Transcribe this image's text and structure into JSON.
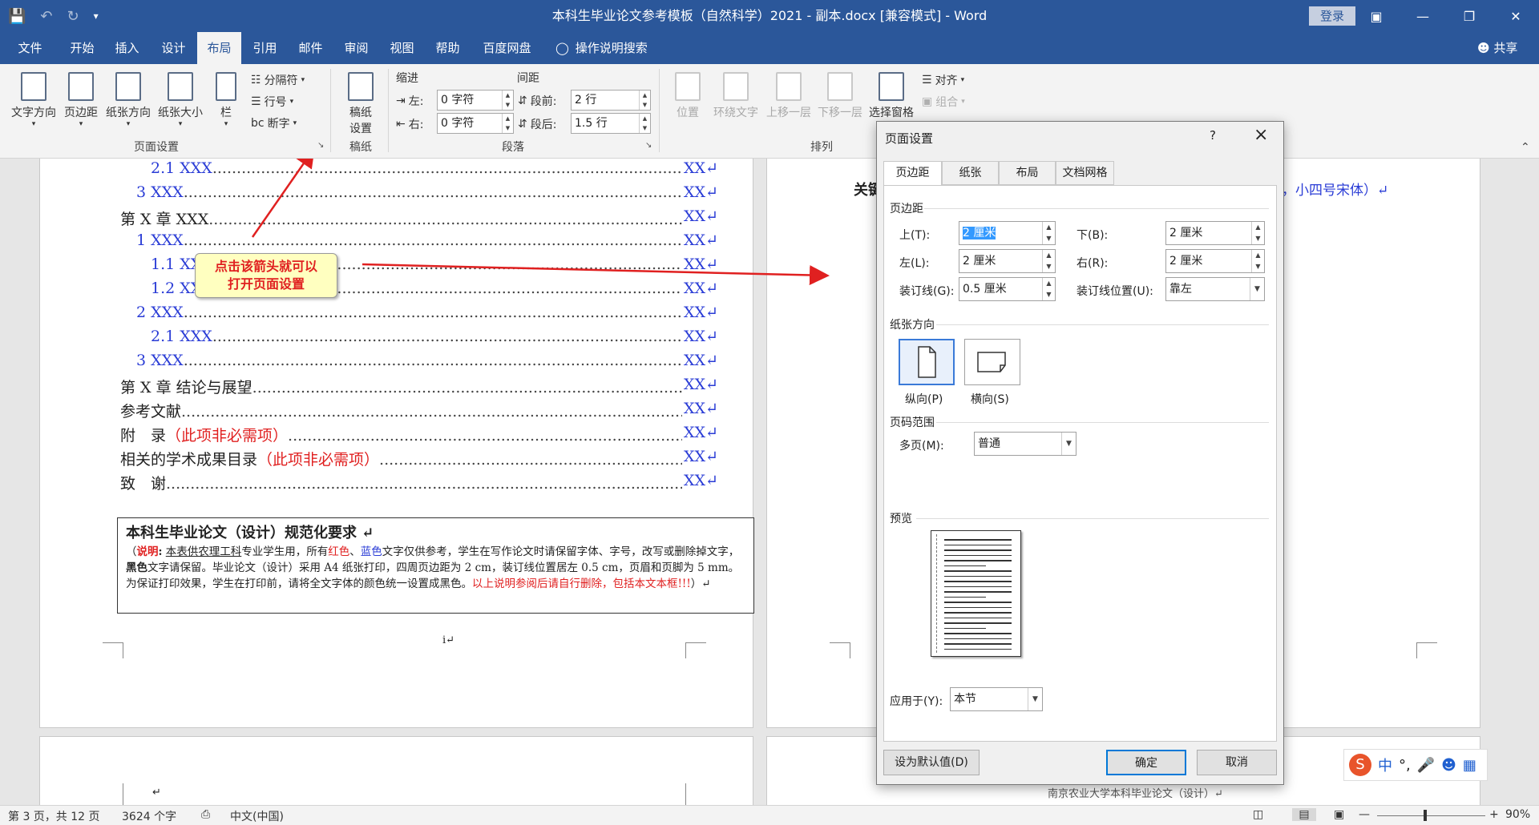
{
  "window": {
    "title": "本科生毕业论文参考模板（自然科学）2021 - 副本.docx [兼容模式] - Word",
    "login": "登录",
    "share": "共享",
    "search": "操作说明搜索"
  },
  "tabs": [
    "文件",
    "开始",
    "插入",
    "设计",
    "布局",
    "引用",
    "邮件",
    "审阅",
    "视图",
    "帮助",
    "百度网盘"
  ],
  "ribbon": {
    "page_setup": {
      "text_direction": "文字方向",
      "margins": "页边距",
      "orientation": "纸张方向",
      "size": "纸张大小",
      "columns": "栏",
      "breaks": "分隔符",
      "line_numbers": "行号",
      "hyphenation": "断字",
      "group": "页面设置"
    },
    "draft": {
      "button_line1": "稿纸",
      "button_line2": "设置",
      "group": "稿纸"
    },
    "paragraph": {
      "indent_label": "缩进",
      "spacing_label": "间距",
      "left_label": "左:",
      "right_label": "右:",
      "before_label": "段前:",
      "after_label": "段后:",
      "left_value": "0 字符",
      "right_value": "0 字符",
      "before_value": "2 行",
      "after_value": "1.5 行",
      "group": "段落"
    },
    "arrange": {
      "position": "位置",
      "wrap": "环绕文字",
      "forward": "上移一层",
      "backward": "下移一层",
      "selection": "选择窗格",
      "align": "对齐",
      "group_btn": "组合",
      "group": "排列"
    }
  },
  "toc": [
    {
      "label": "2.1 XXX",
      "color": "blue",
      "page": "XX"
    },
    {
      "label": "3 XXX",
      "color": "blue",
      "page": "XX"
    },
    {
      "label": "第 X 章 XXX",
      "color": "mixed",
      "page": "XX"
    },
    {
      "label": "1 XXX",
      "color": "blue",
      "page": "XX"
    },
    {
      "label": "1.1 XX",
      "color": "blue",
      "page": "XX"
    },
    {
      "label": "1.2 XX",
      "color": "blue",
      "page": "XX"
    },
    {
      "label": "2 XXX",
      "color": "blue",
      "page": "XX"
    },
    {
      "label": "2.1 XXX",
      "color": "blue",
      "page": "XX"
    },
    {
      "label": "3 XXX",
      "color": "blue",
      "page": "XX"
    },
    {
      "label": "第 X 章 结论与展望",
      "color": "mixed",
      "page": "XX"
    },
    {
      "label": "参考文献",
      "color": "black",
      "page": "XX"
    },
    {
      "label": "附　录",
      "suffix": "（此项非必需项）",
      "color": "black",
      "page": "XX"
    },
    {
      "label": "相关的学术成果目录",
      "suffix": "（此项非必需项）",
      "color": "black",
      "page": "XX"
    },
    {
      "label": "致　谢",
      "color": "black",
      "page": "XX"
    }
  ],
  "callout": {
    "line1": "点击该箭头就可以",
    "line2": "打开页面设置"
  },
  "note": {
    "heading": "本科生毕业论文（设计）规范化要求",
    "p1": "说明",
    "p2": "本表供农理工科",
    "p3": "专业学生用，所有",
    "p4": "红色",
    "p5": "蓝色",
    "p6": "文字仅供参考，学生在写作论文时请保留字体、字号，改写或删除掉文字，",
    "p7": "黑色",
    "p8": "文字请保留。毕业论文（设计）采用 A4 纸张打印，四周页边距为 2 cm，装订线位置居左 0.5 cm，页眉和页脚为 5 mm。为保证打印效果，学生在打印前，请将全文字体的颜色统一设置成黑色。",
    "p9": "以上说明参阅后请自行删除，包括本文本框!!!"
  },
  "page_num": "i",
  "right_page": {
    "keyword": "关键",
    "hint": "，小四号宋体）",
    "footer": "南京农业大学本科毕业论文（设计）"
  },
  "dialog": {
    "title": "页面设置",
    "tabs": [
      "页边距",
      "纸张",
      "布局",
      "文档网格"
    ],
    "margins_section": "页边距",
    "top_label": "上(T):",
    "top_value": "2 厘米",
    "bottom_label": "下(B):",
    "bottom_value": "2 厘米",
    "left_label": "左(L):",
    "left_value": "2 厘米",
    "right_label": "右(R):",
    "right_value": "2 厘米",
    "gutter_label": "装订线(G):",
    "gutter_value": "0.5 厘米",
    "gutter_pos_label": "装订线位置(U):",
    "gutter_pos_value": "靠左",
    "orientation_section": "纸张方向",
    "portrait": "纵向(P)",
    "landscape": "横向(S)",
    "pages_section": "页码范围",
    "multi_label": "多页(M):",
    "multi_value": "普通",
    "preview_section": "预览",
    "apply_label": "应用于(Y):",
    "apply_value": "本节",
    "default_btn": "设为默认值(D)",
    "ok": "确定",
    "cancel": "取消"
  },
  "status": {
    "page": "第 3 页，共 12 页",
    "words": "3624 个字",
    "lang": "中文(中国)",
    "zoom": "90%"
  },
  "ime": {
    "mode": "中"
  }
}
